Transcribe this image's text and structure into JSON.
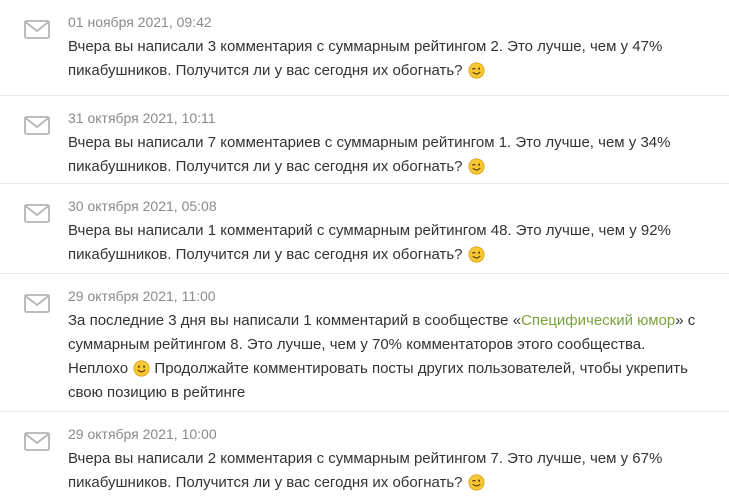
{
  "notifications": [
    {
      "date": "01 ноября 2021, 09:42",
      "line1": "Вчера вы написали 3 комментария с суммарным рейтингом 2. Это лучше, чем у 47%",
      "line2": "пикабушников. Получится ли у вас сегодня их обогнать?",
      "emoji": "wink-emoji"
    },
    {
      "date": "31 октября 2021, 10:11",
      "line1": "Вчера вы написали 7 комментариев с суммарным рейтингом 1. Это лучше, чем у 34%",
      "line2": "пикабушников. Получится ли у вас сегодня их обогнать?",
      "emoji": "wink-emoji"
    },
    {
      "date": "30 октября 2021, 05:08",
      "line1": "Вчера вы написали 1 комментарий с суммарным рейтингом 48. Это лучше, чем у 92%",
      "line2": "пикабушников. Получится ли у вас сегодня их обогнать?",
      "emoji": "wink-emoji"
    },
    {
      "date": "29 октября 2021, 11:00",
      "line1_pre": "За последние 3 дня вы написали 1 комментарий в сообществе",
      "quote_open": "«",
      "community_link": "Специфический юмор",
      "quote_close": "»",
      "line1_post": "с",
      "line2": "суммарным рейтингом 8. Это лучше, чем у 70% комментаторов этого сообщества.",
      "line3_pre": "Неплохо",
      "line3_post": "Продолжайте комментировать посты других пользователей, чтобы укрепить",
      "line4": "свою позицию в рейтинге",
      "emoji": "smile-emoji"
    },
    {
      "date": "29 октября 2021, 10:00",
      "line1": "Вчера вы написали 2 комментария с суммарным рейтингом 7. Это лучше, чем у 67%",
      "line2": "пикабушников. Получится ли у вас сегодня их обогнать?",
      "emoji": "wink-emoji"
    }
  ],
  "colors": {
    "date": "#8a8a8a",
    "text": "#333333",
    "link": "#7aa33a",
    "divider": "#ebebeb",
    "icon": "#b5b5b5",
    "emoji_face": "#f8c834"
  },
  "icons": {
    "notification": "envelope-icon"
  }
}
